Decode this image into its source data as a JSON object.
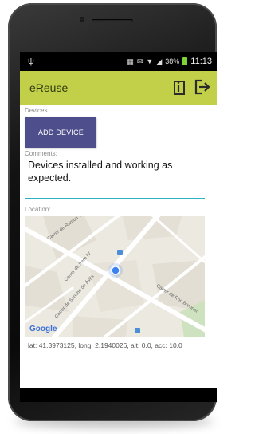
{
  "status_bar": {
    "usb_icon": "usb-icon",
    "icons": [
      "notification-icon",
      "mail-icon",
      "wifi-icon",
      "signal-icon"
    ],
    "battery_text": "38%",
    "time": "11:13"
  },
  "toolbar": {
    "title": "eReuse",
    "info_icon": "info-icon",
    "exit_icon": "exit-icon"
  },
  "devices": {
    "label": "Devices",
    "add_button": "ADD DEVICE"
  },
  "comments": {
    "label": "Comments:",
    "value": "Devices installed and working as expected."
  },
  "location": {
    "label": "Location:",
    "map": {
      "streets": [
        "Carrer de Ramon Turró",
        "Carrer de Roc Boronat",
        "Carrer de Pere IV",
        "Carrer de Sancho de Ávila"
      ],
      "logo": "Google"
    },
    "coords": "lat: 41.3973125, long: 2.1940026, alt: 0.0, acc: 10.0"
  },
  "colors": {
    "toolbar": "#c2cf48",
    "button": "#4e4e8c",
    "accent": "#29b3c4"
  }
}
